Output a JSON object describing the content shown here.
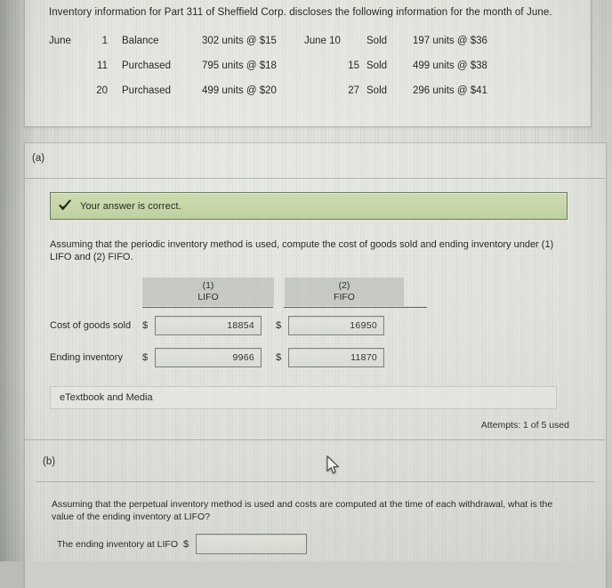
{
  "problem": {
    "intro": "Inventory information for Part 311 of Sheffield Corp. discloses the following information for the month of June.",
    "rows": [
      {
        "month": "June",
        "day": "1",
        "activity": "Balance",
        "detail": "302 units @ $15",
        "month2": "June 10",
        "activity2": "Sold",
        "detail2": "197 units @ $36"
      },
      {
        "month": "",
        "day": "11",
        "activity": "Purchased",
        "detail": "795 units @ $18",
        "month2": "15",
        "activity2": "Sold",
        "detail2": "499 units @ $38"
      },
      {
        "month": "",
        "day": "20",
        "activity": "Purchased",
        "detail": "499 units @ $20",
        "month2": "27",
        "activity2": "Sold",
        "detail2": "296 units @ $41"
      }
    ]
  },
  "part_a": {
    "label": "(a)",
    "banner": {
      "icon": "checkmark-icon",
      "text": "Your answer is correct.",
      "color": "#c6d6a9"
    },
    "prompt": "Assuming that the periodic inventory method is used, compute the cost of goods sold and ending inventory under (1) LIFO and (2) FIFO.",
    "columns": [
      {
        "number": "(1)",
        "method": "LIFO"
      },
      {
        "number": "(2)",
        "method": "FIFO"
      }
    ],
    "rows": [
      {
        "label": "Cost of goods sold",
        "currency": "$",
        "lifo": "18854",
        "fifo": "16950"
      },
      {
        "label": "Ending inventory",
        "currency": "$",
        "lifo": "9966",
        "fifo": "11870"
      }
    ],
    "etextbook_label": "eTextbook and Media",
    "attempts": "Attempts: 1 of 5 used"
  },
  "part_b": {
    "label": "(b)",
    "prompt": "Assuming that the perpetual inventory method is used and costs are computed at the time of each withdrawal, what is the value of the ending inventory at LIFO?",
    "answer_label": "The ending inventory at LIFO",
    "currency": "$",
    "value": "",
    "placeholder": ""
  }
}
